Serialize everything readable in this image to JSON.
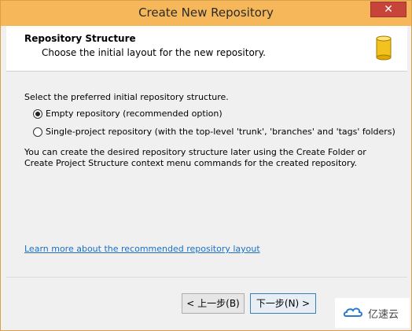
{
  "window": {
    "title": "Create New Repository",
    "close_glyph": "✕"
  },
  "header": {
    "title": "Repository Structure",
    "subtitle": "Choose the initial layout for the new repository."
  },
  "content": {
    "prompt": "Select the preferred initial repository structure.",
    "options": [
      {
        "label": "Empty repository (recommended option)",
        "checked": true
      },
      {
        "label": "Single-project repository (with the top-level 'trunk', 'branches' and 'tags' folders)",
        "checked": false
      }
    ],
    "note": "You can create the desired repository structure later using the Create Folder or Create Project Structure context menu commands for the created repository.",
    "link": "Learn more about the recommended repository layout"
  },
  "footer": {
    "back_label": "< 上一步(B)",
    "next_label": "下一步(N) >"
  },
  "watermark": {
    "text": "亿速云"
  },
  "colors": {
    "titlebar": "#f5b759",
    "close": "#c7443a",
    "link": "#1c6fc4",
    "db_icon": "#f2c21e"
  }
}
